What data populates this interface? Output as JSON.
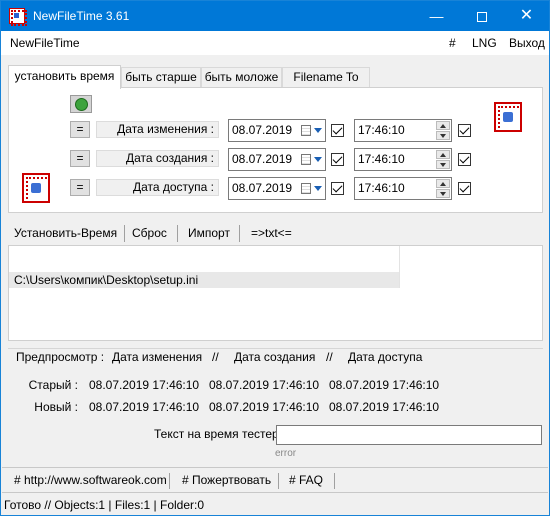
{
  "window": {
    "title": "NewFileTime 3.61"
  },
  "menu": {
    "app": "NewFileTime",
    "hash": "#",
    "lng": "LNG",
    "exit": "Выход"
  },
  "tabs": [
    {
      "label": "установить время",
      "active": true
    },
    {
      "label": "быть старше"
    },
    {
      "label": "быть моложе"
    },
    {
      "label": "Filename To Time"
    }
  ],
  "eq_label": "=",
  "rows": [
    {
      "label": "Дата изменения :",
      "date": "08.07.2019",
      "time": "17:46:10",
      "date_checked": true,
      "time_checked": true
    },
    {
      "label": "Дата создания :",
      "date": "08.07.2019",
      "time": "17:46:10",
      "date_checked": true,
      "time_checked": true
    },
    {
      "label": "Дата доступа :",
      "date": "08.07.2019",
      "time": "17:46:10",
      "date_checked": true,
      "time_checked": true
    }
  ],
  "toolbar": {
    "set_time": "Установить-Время",
    "reset": "Сброс",
    "import": "Импорт",
    "txt": "=>txt<="
  },
  "files": [
    "C:\\Users\\компик\\Desktop\\setup.ini"
  ],
  "preview": {
    "head_label": "Предпросмотр :",
    "col_modified": "Дата изменения",
    "sep1": "//",
    "col_created": "Дата создания",
    "sep2": "//",
    "col_accessed": "Дата доступа",
    "old_label": "Старый :",
    "new_label": "Новый :",
    "old": [
      "08.07.2019 17:46:10",
      "08.07.2019 17:46:10",
      "08.07.2019 17:46:10"
    ],
    "new": [
      "08.07.2019 17:46:10",
      "08.07.2019 17:46:10",
      "08.07.2019 17:46:10"
    ]
  },
  "tester": {
    "label": "Текст на время тестер",
    "value": "",
    "error": "error"
  },
  "links": {
    "website": "# http://www.softwareok.com",
    "donate": "# Пожертвовать",
    "faq": "# FAQ"
  },
  "status": "Готово // Objects:1 | Files:1  | Folder:0"
}
